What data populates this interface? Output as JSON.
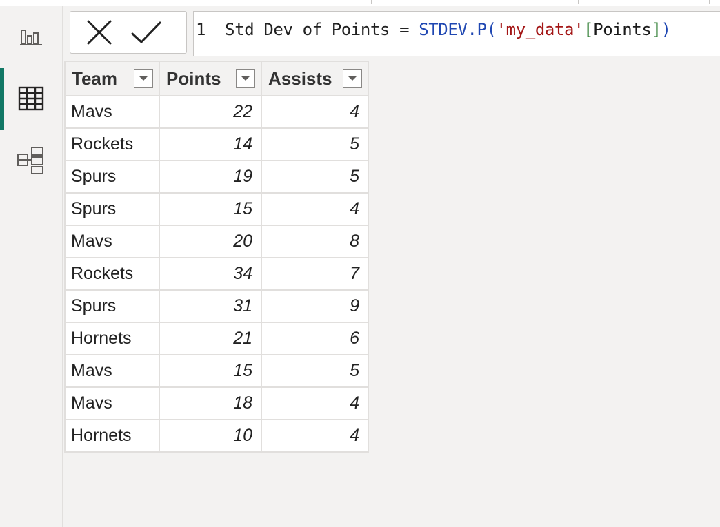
{
  "rail": [
    {
      "name": "report-view-icon",
      "active": false
    },
    {
      "name": "data-view-icon",
      "active": true
    },
    {
      "name": "model-view-icon",
      "active": false
    }
  ],
  "formula": {
    "line_number": "1",
    "measure_name": "Std Dev of Points",
    "equals": "=",
    "function": "STDEV.P",
    "open_paren": "(",
    "table_ref": "'my_data'",
    "column_ref": "[Points]",
    "close_paren": ")"
  },
  "table": {
    "headers": [
      "Team",
      "Points",
      "Assists"
    ],
    "rows": [
      [
        "Mavs",
        "22",
        "4"
      ],
      [
        "Rockets",
        "14",
        "5"
      ],
      [
        "Spurs",
        "19",
        "5"
      ],
      [
        "Spurs",
        "15",
        "4"
      ],
      [
        "Mavs",
        "20",
        "8"
      ],
      [
        "Rockets",
        "34",
        "7"
      ],
      [
        "Spurs",
        "31",
        "9"
      ],
      [
        "Hornets",
        "21",
        "6"
      ],
      [
        "Mavs",
        "15",
        "5"
      ],
      [
        "Mavs",
        "18",
        "4"
      ],
      [
        "Hornets",
        "10",
        "4"
      ]
    ]
  },
  "colors": {
    "accent": "#117865",
    "function": "#1f47b2",
    "string": "#a31515"
  }
}
